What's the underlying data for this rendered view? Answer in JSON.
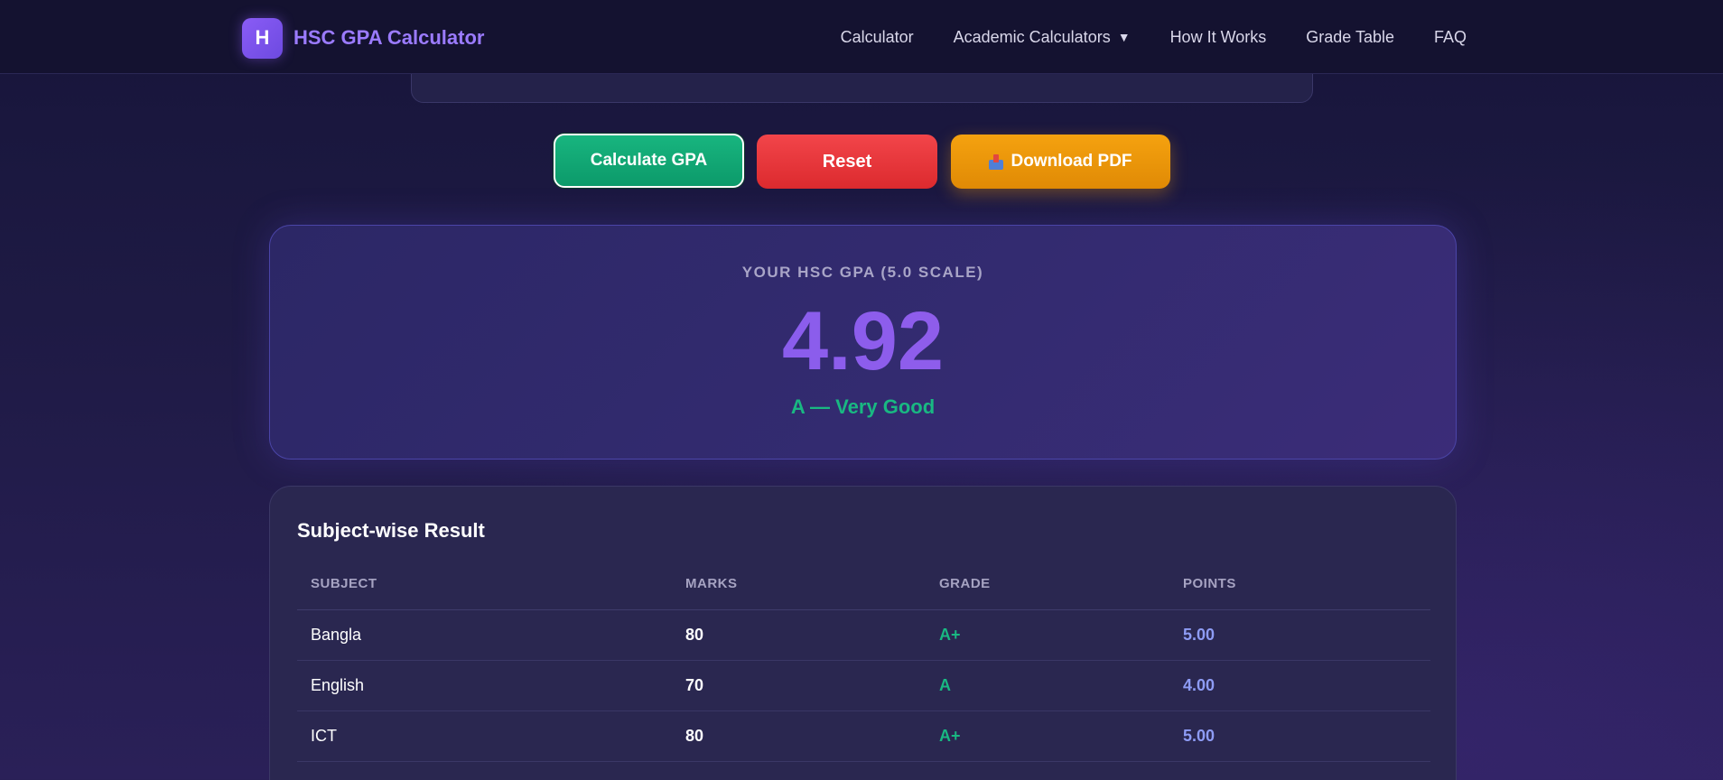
{
  "brand": {
    "logo_letter": "H",
    "name": "HSC GPA Calculator"
  },
  "nav": {
    "items": [
      {
        "label": "Calculator"
      },
      {
        "label": "Academic Calculators",
        "caret": "▼"
      },
      {
        "label": "How It Works"
      },
      {
        "label": "Grade Table"
      },
      {
        "label": "FAQ"
      }
    ]
  },
  "actions": {
    "calculate_label": "Calculate GPA",
    "reset_label": "Reset",
    "download_label": "Download PDF",
    "download_icon": "outbox-tray-icon"
  },
  "result": {
    "label": "YOUR HSC GPA (5.0 SCALE)",
    "gpa": "4.92",
    "grade_text": "A — Very Good"
  },
  "subjects": {
    "title": "Subject-wise Result",
    "columns": [
      "SUBJECT",
      "MARKS",
      "GRADE",
      "POINTS"
    ],
    "rows": [
      {
        "subject": "Bangla",
        "marks": "80",
        "grade": "A+",
        "points": "5.00"
      },
      {
        "subject": "English",
        "marks": "70",
        "grade": "A",
        "points": "4.00"
      },
      {
        "subject": "ICT",
        "marks": "80",
        "grade": "A+",
        "points": "5.00"
      }
    ]
  },
  "colors": {
    "accent": "#8b5cf6",
    "success": "#10b981",
    "danger": "#ef4444",
    "warning": "#f59e0b",
    "points": "#8e9cf5"
  }
}
